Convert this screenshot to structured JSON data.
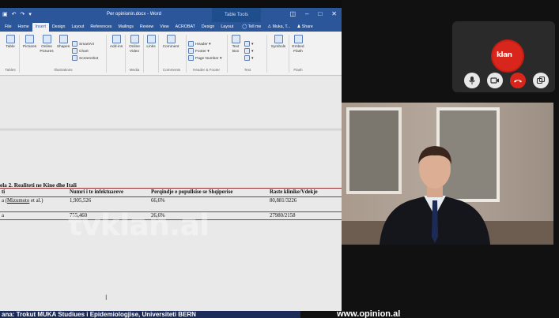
{
  "word": {
    "doc_title": "Per opinionin.docx - Word",
    "context_tab_title": "Table Tools",
    "tabs": [
      "File",
      "Home",
      "Insert",
      "Design",
      "Layout",
      "References",
      "Mailings",
      "Review",
      "View",
      "ACROBAT",
      "Design",
      "Layout"
    ],
    "active_tab": "Insert",
    "tell_me": "Tell me",
    "user": "Muka, T...",
    "share": "Share",
    "ribbon": {
      "table": "Table",
      "pictures": "Pictures",
      "online_pictures": "Online Pictures",
      "shapes": "Shapes",
      "smartart": "SmartArt",
      "chart": "Chart",
      "screenshot": "Screenshot",
      "addins": "Add-ins",
      "online_video": "Online Video",
      "links": "Links",
      "comment": "Comment",
      "header": "Header",
      "footer": "Footer",
      "page_number": "Page Number",
      "text_box": "Text Box",
      "symbols": "Symbols",
      "embed_flash": "Embed Flash",
      "groups": {
        "tables": "Tables",
        "illustrations": "Illustrations",
        "media": "Media",
        "comments": "Comments",
        "header_footer": "Header & Footer",
        "text": "Text",
        "flash": "Flash"
      }
    },
    "document": {
      "caption": "ela 2. Realiteti ne Kine dhe Itali",
      "headers": [
        "ti",
        "Numri i te infektuareve",
        "Perqindje e popullsise se Shqiperise",
        "Raste klinike/Vdekje"
      ],
      "rows": [
        [
          "a (Mizumoto et al.)",
          "1,905,526",
          "66,6%",
          "80,881/3226"
        ],
        [
          "a",
          "755,460",
          "26,6%",
          "27980/2158"
        ]
      ],
      "underlined_word": "Mizumoto"
    }
  },
  "watermark": "tvklan.al",
  "call_logo": "klan",
  "ticker": {
    "left": "ana: Trokut MUKA Studiues i Epidemiologjise, Universiteti BERN",
    "right": "www.opinion.al"
  },
  "colors": {
    "word_blue": "#2b579a",
    "logo_red": "#d9261c",
    "ticker_blue": "#1c2b58"
  }
}
